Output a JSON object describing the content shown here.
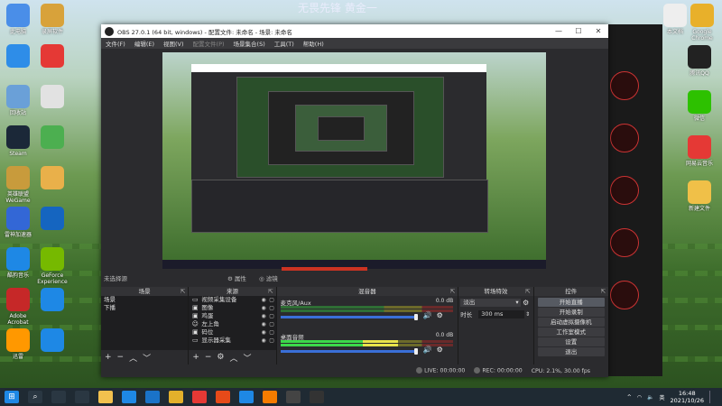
{
  "desktop": {
    "background_text": "无畏先锋 黄金一",
    "left_icons": [
      {
        "label": "此电脑",
        "color": "#4a8ee8"
      },
      {
        "label": "录屏软件",
        "color": "#d8a23a"
      },
      {
        "label": "",
        "color": "#2e8de8"
      },
      {
        "label": "",
        "color": "#e53935"
      },
      {
        "label": "回收站",
        "color": "#6aa0d8"
      },
      {
        "label": "",
        "color": "#e2e2e2"
      },
      {
        "label": "Steam",
        "color": "#1b2838"
      },
      {
        "label": "",
        "color": "#4caf50"
      },
      {
        "label": "英雄联盟WeGame",
        "color": "#c89b3c"
      },
      {
        "label": "",
        "color": "#e9b04a"
      },
      {
        "label": "雷神加速器",
        "color": "#3367d6"
      },
      {
        "label": "",
        "color": "#1565c0"
      },
      {
        "label": "酷狗音乐",
        "color": "#1e88e5"
      },
      {
        "label": "GeForce Experience",
        "color": "#76b900"
      },
      {
        "label": "Adobe Acrobat",
        "color": "#c62828"
      },
      {
        "label": "",
        "color": "#1e88e5"
      },
      {
        "label": "迅雷",
        "color": "#ff9800"
      },
      {
        "label": "",
        "color": "#1e88e5"
      }
    ],
    "right_icons": [
      {
        "label": "本文档",
        "color": "#eeeeee"
      },
      {
        "label": "Google Chrome",
        "color": "#e8b02a"
      },
      {
        "label": "腾讯QQ",
        "color": "#222222"
      },
      {
        "label": "微信",
        "color": "#2dc100"
      },
      {
        "label": "网易云音乐",
        "color": "#e53935"
      },
      {
        "label": "新建文件",
        "color": "#f0c048"
      }
    ]
  },
  "obs": {
    "title": "OBS 27.0.1 (64 bit, windows) - 配置文件: 未命名 - 场景: 未命名",
    "menu": [
      "文件(F)",
      "编辑(E)",
      "视图(V)",
      "配置文件(P)",
      "场景集合(S)",
      "工具(T)",
      "帮助(H)"
    ],
    "window_buttons": {
      "minimize": "—",
      "maximize": "☐",
      "close": "✕"
    },
    "toolbar": {
      "scene_label": "未选择源",
      "properties": "属性",
      "filters": "滤镜"
    },
    "scenes_dock": {
      "title": "场景",
      "items": [
        {
          "name": "场景",
          "selected": false
        },
        {
          "name": "下播",
          "selected": false
        }
      ]
    },
    "sources_dock": {
      "title": "来源",
      "items": [
        {
          "icon": "video-capture-icon",
          "glyph": "▭",
          "name": "视频采集设备"
        },
        {
          "icon": "image-icon",
          "glyph": "▣",
          "name": "图像"
        },
        {
          "icon": "image-icon",
          "glyph": "▣",
          "name": "鸡蛋"
        },
        {
          "icon": "user-icon",
          "glyph": "☺",
          "name": "左上角"
        },
        {
          "icon": "image-icon",
          "glyph": "▣",
          "name": "码位"
        },
        {
          "icon": "monitor-icon",
          "glyph": "▭",
          "name": "显示器采集"
        }
      ]
    },
    "mixer_dock": {
      "title": "混音器",
      "channels": [
        {
          "name": "麦克风/Aux",
          "db": "0.0 dB",
          "level_pct": 0,
          "volume_pct": 100
        },
        {
          "name": "桌面音频",
          "db": "0.0 dB",
          "level_pct": 68,
          "volume_pct": 100
        }
      ]
    },
    "transitions_dock": {
      "title": "转场特效",
      "type": "淡出",
      "duration_label": "时长",
      "duration_value": "300 ms"
    },
    "controls_dock": {
      "title": "控件",
      "buttons": [
        "开始直播",
        "开始录制",
        "启动虚拟摄像机",
        "工作室模式",
        "设置",
        "退出"
      ]
    },
    "status": {
      "live": "LIVE: 00:00:00",
      "rec": "REC: 00:00:00",
      "cpu": "CPU: 2.1%, 30.00 fps"
    }
  },
  "taskbar": {
    "apps": [
      {
        "icon": "windows-start-icon",
        "color": "#1e88e5"
      },
      {
        "icon": "search-icon",
        "color": "#2a3742"
      },
      {
        "icon": "task-view-icon",
        "color": "#2a3742"
      },
      {
        "icon": "app-icon",
        "color": "#2a3742"
      },
      {
        "icon": "file-explorer-icon",
        "color": "#f2c14e"
      },
      {
        "icon": "app-icon",
        "color": "#1e88e5"
      },
      {
        "icon": "edge-icon",
        "color": "#1a73c8"
      },
      {
        "icon": "chrome-icon",
        "color": "#e3b02b"
      },
      {
        "icon": "netease-icon",
        "color": "#e53935"
      },
      {
        "icon": "app-icon",
        "color": "#e64a19"
      },
      {
        "icon": "edge-icon",
        "color": "#1e88e5"
      },
      {
        "icon": "app-icon",
        "color": "#f57c00"
      },
      {
        "icon": "app-icon",
        "color": "#444444"
      },
      {
        "icon": "obs-icon",
        "color": "#333333"
      }
    ],
    "tray_lang": "英",
    "time": "16:48",
    "date": "2021/10/26"
  }
}
